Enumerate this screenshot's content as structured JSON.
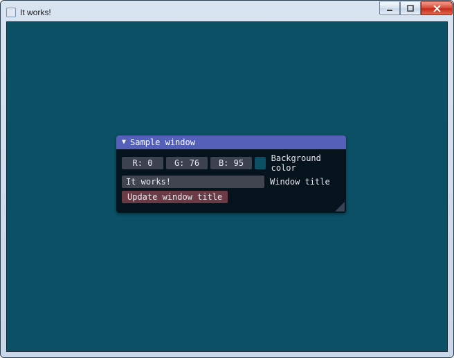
{
  "window": {
    "title": "It works!"
  },
  "panel": {
    "title": "Sample window",
    "rgb": {
      "r_label": "R: 0",
      "g_label": "G: 76",
      "b_label": "B: 95",
      "r": 0,
      "g": 76,
      "b": 95,
      "field_label": "Background color",
      "swatch_hex": "#0b5064"
    },
    "title_input": {
      "value": "It works!",
      "field_label": "Window title"
    },
    "update_button": "Update window title"
  }
}
